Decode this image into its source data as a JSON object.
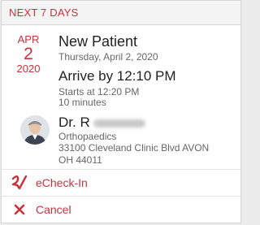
{
  "header": {
    "title": "NEXT 7 DAYS"
  },
  "appointment": {
    "month": "APR",
    "day": "2",
    "year": "2020",
    "title": "New Patient",
    "date_line": "Thursday, April 2, 2020",
    "arrive_by": "Arrive by 12:10 PM",
    "starts_at": "Starts at 12:20 PM",
    "duration": "10 minutes"
  },
  "provider": {
    "name": "Dr. R",
    "specialty": "Orthopaedics",
    "address_line1": "33100 Cleveland Clinic Blvd AVON",
    "address_line2": "OH 44011"
  },
  "actions": {
    "echeckin_label": "eCheck-In",
    "cancel_label": "Cancel"
  },
  "colors": {
    "accent": "#c8323d"
  }
}
